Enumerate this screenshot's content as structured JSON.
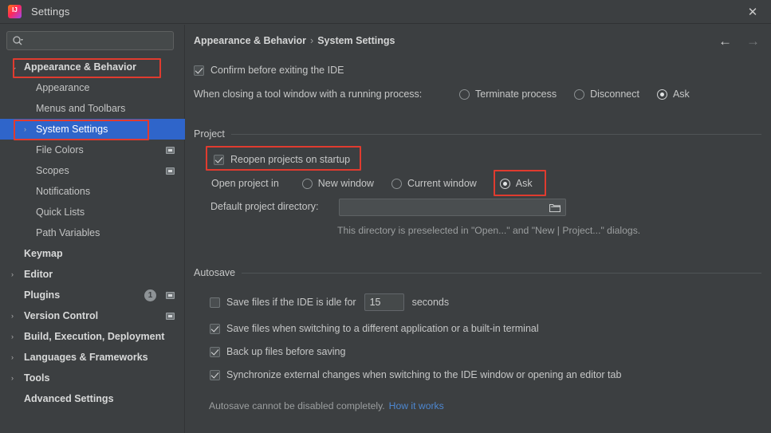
{
  "window": {
    "title": "Settings",
    "app_icon": "intellij-idea-icon",
    "close_label": "✕"
  },
  "search": {
    "value": "",
    "placeholder": "",
    "icon": "search-icon"
  },
  "sidebar": {
    "items": [
      {
        "label": "Appearance & Behavior",
        "level": 1,
        "arrow": "⌄",
        "expanded": true,
        "bold": true,
        "selected": false,
        "badge": null,
        "mark": false
      },
      {
        "label": "Appearance",
        "level": 2,
        "arrow": "",
        "expanded": false,
        "bold": false,
        "selected": false,
        "badge": null,
        "mark": false
      },
      {
        "label": "Menus and Toolbars",
        "level": 2,
        "arrow": "",
        "expanded": false,
        "bold": false,
        "selected": false,
        "badge": null,
        "mark": false
      },
      {
        "label": "System Settings",
        "level": 2,
        "arrow": "›",
        "expanded": false,
        "bold": false,
        "selected": true,
        "badge": null,
        "mark": false
      },
      {
        "label": "File Colors",
        "level": 2,
        "arrow": "",
        "expanded": false,
        "bold": false,
        "selected": false,
        "badge": null,
        "mark": true
      },
      {
        "label": "Scopes",
        "level": 2,
        "arrow": "",
        "expanded": false,
        "bold": false,
        "selected": false,
        "badge": null,
        "mark": true
      },
      {
        "label": "Notifications",
        "level": 2,
        "arrow": "",
        "expanded": false,
        "bold": false,
        "selected": false,
        "badge": null,
        "mark": false
      },
      {
        "label": "Quick Lists",
        "level": 2,
        "arrow": "",
        "expanded": false,
        "bold": false,
        "selected": false,
        "badge": null,
        "mark": false
      },
      {
        "label": "Path Variables",
        "level": 2,
        "arrow": "",
        "expanded": false,
        "bold": false,
        "selected": false,
        "badge": null,
        "mark": false
      },
      {
        "label": "Keymap",
        "level": 1,
        "arrow": "",
        "expanded": false,
        "bold": true,
        "selected": false,
        "badge": null,
        "mark": false
      },
      {
        "label": "Editor",
        "level": 1,
        "arrow": "›",
        "expanded": false,
        "bold": true,
        "selected": false,
        "badge": null,
        "mark": false
      },
      {
        "label": "Plugins",
        "level": 1,
        "arrow": "",
        "expanded": false,
        "bold": true,
        "selected": false,
        "badge": "1",
        "mark": true
      },
      {
        "label": "Version Control",
        "level": 1,
        "arrow": "›",
        "expanded": false,
        "bold": true,
        "selected": false,
        "badge": null,
        "mark": true
      },
      {
        "label": "Build, Execution, Deployment",
        "level": 1,
        "arrow": "›",
        "expanded": false,
        "bold": true,
        "selected": false,
        "badge": null,
        "mark": false
      },
      {
        "label": "Languages & Frameworks",
        "level": 1,
        "arrow": "›",
        "expanded": false,
        "bold": true,
        "selected": false,
        "badge": null,
        "mark": false
      },
      {
        "label": "Tools",
        "level": 1,
        "arrow": "›",
        "expanded": false,
        "bold": true,
        "selected": false,
        "badge": null,
        "mark": false
      },
      {
        "label": "Advanced Settings",
        "level": 1,
        "arrow": "",
        "expanded": false,
        "bold": true,
        "selected": false,
        "badge": null,
        "mark": false
      }
    ]
  },
  "breadcrumb": {
    "parent": "Appearance & Behavior",
    "separator": "›",
    "current": "System Settings"
  },
  "nav": {
    "back_icon": "←",
    "forward_icon": "→"
  },
  "main": {
    "confirm_exit": {
      "label": "Confirm before exiting the IDE",
      "checked": true
    },
    "tool_window": {
      "label": "When closing a tool window with a running process:",
      "options": [
        {
          "label": "Terminate process",
          "selected": false
        },
        {
          "label": "Disconnect",
          "selected": false
        },
        {
          "label": "Ask",
          "selected": true
        }
      ]
    },
    "project": {
      "group_title": "Project",
      "reopen": {
        "label": "Reopen projects on startup",
        "checked": true,
        "highlighted": true
      },
      "open_project_in": {
        "label": "Open project in",
        "options": [
          {
            "label": "New window",
            "selected": false,
            "highlighted": false
          },
          {
            "label": "Current window",
            "selected": false,
            "highlighted": false
          },
          {
            "label": "Ask",
            "selected": true,
            "highlighted": true
          }
        ]
      },
      "default_dir": {
        "label": "Default project directory:",
        "value": "",
        "browse_icon": "folder-icon"
      },
      "hint": "This directory is preselected in \"Open...\" and \"New | Project...\" dialogs."
    },
    "autosave": {
      "group_title": "Autosave",
      "idle": {
        "label": "Save files if the IDE is idle for",
        "checked": false,
        "value": "15",
        "unit": "seconds"
      },
      "on_switch": {
        "label": "Save files when switching to a different application or a built-in terminal",
        "checked": true
      },
      "backup": {
        "label": "Back up files before saving",
        "checked": true
      },
      "sync": {
        "label": "Synchronize external changes when switching to the IDE window or opening an editor tab",
        "checked": true
      },
      "note": "Autosave cannot be disabled completely.",
      "note_link": "How it works"
    }
  },
  "colors": {
    "background": "#3c3f41",
    "selection": "#2f65ca",
    "annotation": "#e03b2f",
    "link": "#4d87d0",
    "text": "#c6c7c7"
  }
}
